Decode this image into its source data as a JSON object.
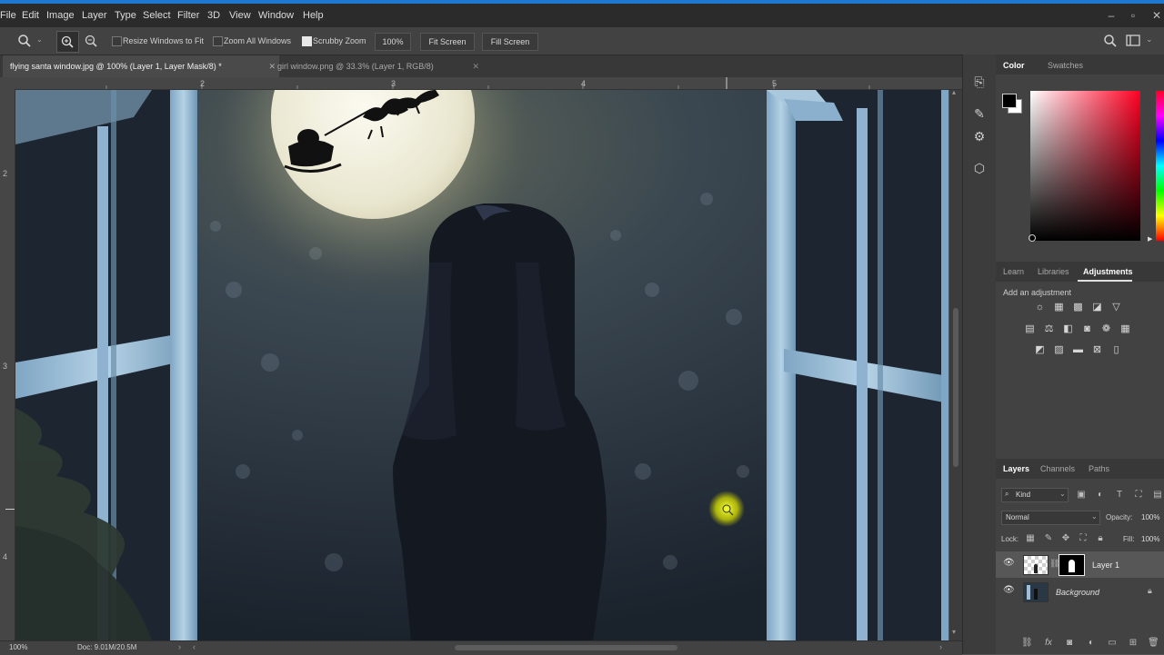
{
  "menubar": {
    "items": [
      "File",
      "Edit",
      "Image",
      "Layer",
      "Type",
      "Select",
      "Filter",
      "3D",
      "View",
      "Window",
      "Help"
    ]
  },
  "options_bar": {
    "resize_windows": "Resize Windows to Fit",
    "zoom_all": "Zoom All Windows",
    "scrubby_zoom": "Scrubby Zoom",
    "zoom_value": "100%",
    "fit_screen": "Fit Screen",
    "fill_screen": "Fill Screen"
  },
  "doc_tabs": [
    {
      "label": "flying santa window.jpg @ 100% (Layer 1, Layer Mask/8) *",
      "active": true
    },
    {
      "label": "girl window.png @ 33.3% (Layer 1, RGB/8)",
      "active": false
    }
  ],
  "rulers": {
    "top": [
      "2",
      "3",
      "4",
      "5"
    ],
    "left": [
      "2",
      "3",
      "4"
    ]
  },
  "status": {
    "zoom": "100%",
    "doc": "Doc: 9.01M/20.5M"
  },
  "color_panel": {
    "tabs": [
      "Color",
      "Swatches"
    ],
    "foreground": "#000000",
    "background": "#ffffff",
    "hue": "#ff0022"
  },
  "adjustments_panel": {
    "tabs": [
      "Learn",
      "Libraries",
      "Adjustments"
    ],
    "hint": "Add an adjustment"
  },
  "layers_panel": {
    "tabs": [
      "Layers",
      "Channels",
      "Paths"
    ],
    "filter_kind": "Kind",
    "blend_mode": "Normal",
    "opacity_label": "Opacity:",
    "opacity_value": "100%",
    "lock_label": "Lock:",
    "fill_label": "Fill:",
    "fill_value": "100%",
    "layers": [
      {
        "name": "Layer 1"
      },
      {
        "name": "Background"
      }
    ]
  }
}
